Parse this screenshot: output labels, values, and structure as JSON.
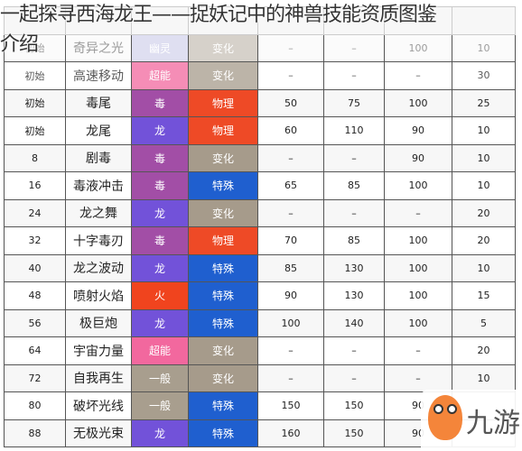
{
  "title": {
    "line1": "一起探寻西海龙王——捉妖记中的神兽技能资质图鉴",
    "line2": "介绍"
  },
  "colors": {
    "幽灵": "#b9b9e2",
    "超能": "#f2689e",
    "毒": "#a24ea6",
    "龙": "#7252d9",
    "火": "#f0441e",
    "一般": "#a89e8e",
    "物理": "#ee4a26",
    "变化": "#a69b8b",
    "特殊": "#1f5fcf"
  },
  "rows": [
    {
      "level": "初始",
      "name": "奇异之光",
      "type": "幽灵",
      "category": "变化",
      "power": "–",
      "accuracy": "–",
      "c3": "100",
      "pp": "10"
    },
    {
      "level": "初始",
      "name": "高速移动",
      "type": "超能",
      "category": "变化",
      "power": "–",
      "accuracy": "–",
      "c3": "–",
      "pp": "30"
    },
    {
      "level": "初始",
      "name": "毒尾",
      "type": "毒",
      "category": "物理",
      "power": "50",
      "accuracy": "75",
      "c3": "100",
      "pp": "25"
    },
    {
      "level": "初始",
      "name": "龙尾",
      "type": "龙",
      "category": "物理",
      "power": "60",
      "accuracy": "110",
      "c3": "90",
      "pp": "10"
    },
    {
      "level": "8",
      "name": "剧毒",
      "type": "毒",
      "category": "变化",
      "power": "–",
      "accuracy": "–",
      "c3": "90",
      "pp": "10"
    },
    {
      "level": "16",
      "name": "毒液冲击",
      "type": "毒",
      "category": "特殊",
      "power": "65",
      "accuracy": "85",
      "c3": "100",
      "pp": "10"
    },
    {
      "level": "24",
      "name": "龙之舞",
      "type": "龙",
      "category": "变化",
      "power": "–",
      "accuracy": "–",
      "c3": "–",
      "pp": "20"
    },
    {
      "level": "32",
      "name": "十字毒刃",
      "type": "毒",
      "category": "物理",
      "power": "70",
      "accuracy": "85",
      "c3": "100",
      "pp": "20"
    },
    {
      "level": "40",
      "name": "龙之波动",
      "type": "龙",
      "category": "特殊",
      "power": "85",
      "accuracy": "130",
      "c3": "100",
      "pp": "10"
    },
    {
      "level": "48",
      "name": "喷射火焰",
      "type": "火",
      "category": "特殊",
      "power": "90",
      "accuracy": "130",
      "c3": "100",
      "pp": "15"
    },
    {
      "level": "56",
      "name": "极巨炮",
      "type": "龙",
      "category": "特殊",
      "power": "100",
      "accuracy": "140",
      "c3": "100",
      "pp": "5"
    },
    {
      "level": "64",
      "name": "宇宙力量",
      "type": "超能",
      "category": "变化",
      "power": "–",
      "accuracy": "–",
      "c3": "–",
      "pp": "20"
    },
    {
      "level": "72",
      "name": "自我再生",
      "type": "一般",
      "category": "变化",
      "power": "–",
      "accuracy": "–",
      "c3": "–",
      "pp": "10"
    },
    {
      "level": "80",
      "name": "破坏光线",
      "type": "一般",
      "category": "特殊",
      "power": "150",
      "accuracy": "150",
      "c3": "90",
      "pp": ""
    },
    {
      "level": "88",
      "name": "无极光束",
      "type": "龙",
      "category": "特殊",
      "power": "160",
      "accuracy": "150",
      "c3": "90",
      "pp": ""
    }
  ],
  "watermark": {
    "text": "九游",
    "icon": "mascot-logo"
  }
}
